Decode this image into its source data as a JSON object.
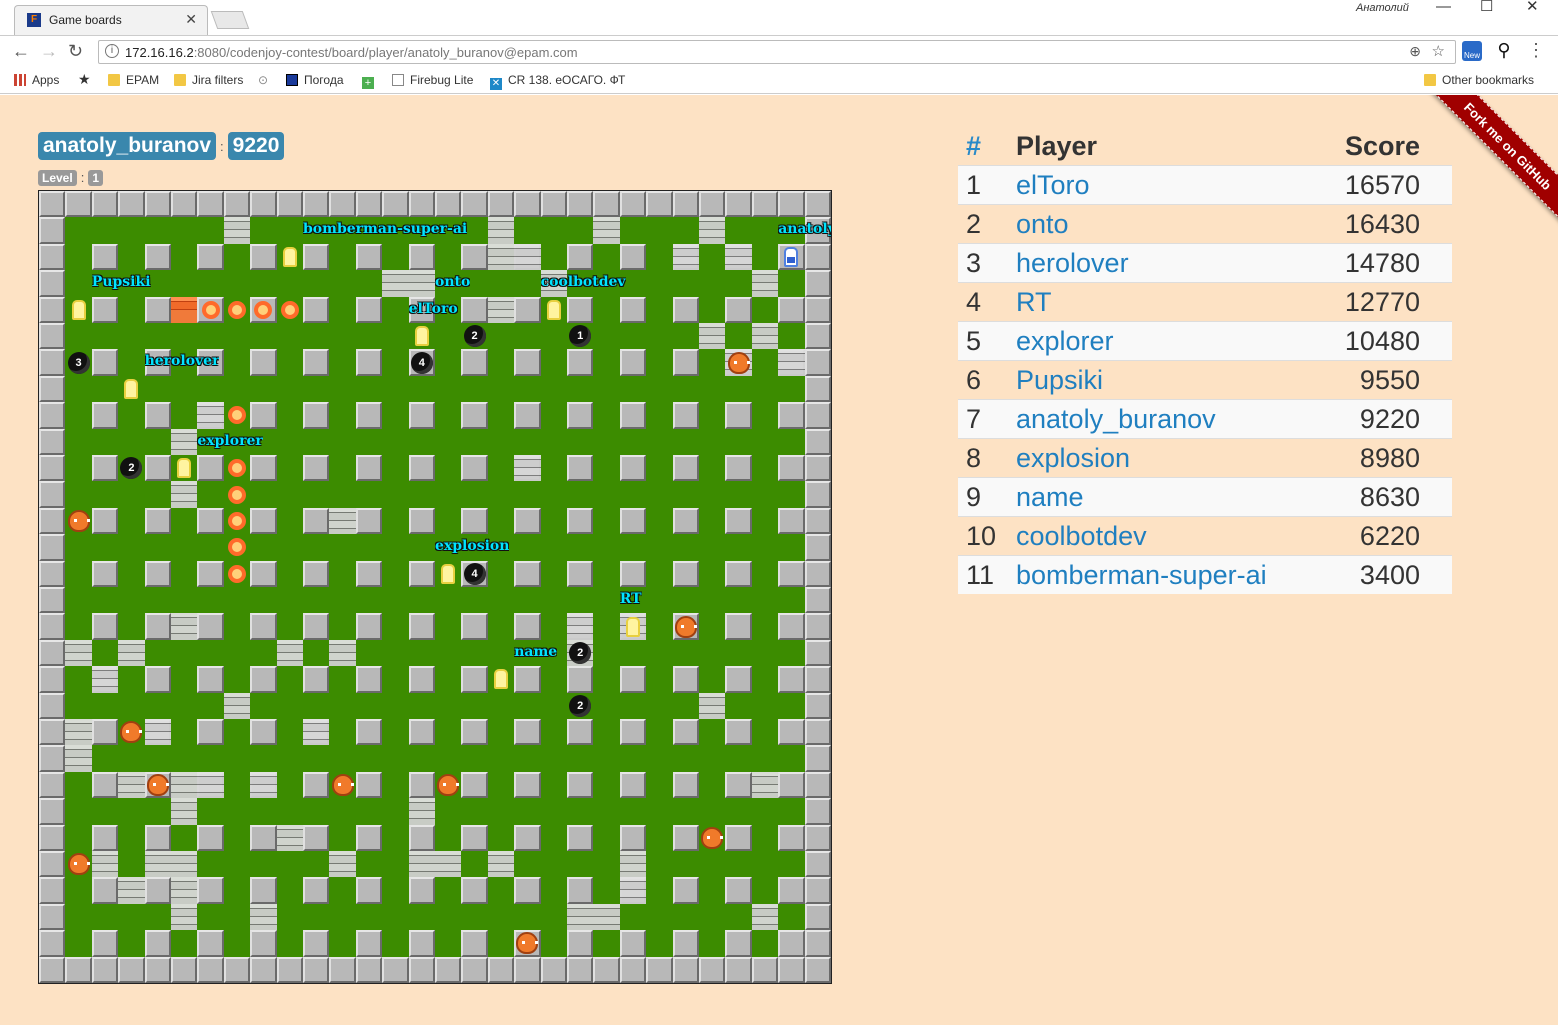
{
  "browser": {
    "tab_title": "Game boards",
    "tab_favicon": "F",
    "user_name": "Анатолий",
    "window_min": "—",
    "window_max": "☐",
    "window_close": "✕",
    "url_host": "172.16.16.2",
    "url_rest": ":8080/codenjoy-contest/board/player/anatoly_buranov@epam.com",
    "ext1_label": "New",
    "bookmarks": [
      {
        "label": "Apps",
        "icon": "apps-grid-icon"
      },
      {
        "label": "",
        "icon": "star-icon"
      },
      {
        "label": "EPAM",
        "icon": "folder-icon"
      },
      {
        "label": "Jira filters",
        "icon": "folder-icon"
      },
      {
        "label": "",
        "icon": "map-pin-icon"
      },
      {
        "label": "Погода",
        "icon": "weather-icon"
      },
      {
        "label": "",
        "icon": "plus-icon"
      },
      {
        "label": "Firebug Lite",
        "icon": "page-icon"
      },
      {
        "label": "CR 138. еОСАГО. ФТ",
        "icon": "x-icon"
      },
      {
        "label": "Other bookmarks",
        "icon": "folder-icon"
      }
    ]
  },
  "player": {
    "name": "anatoly_buranov",
    "separator": ":",
    "score": "9220",
    "level_label": "Level",
    "level": "1"
  },
  "ribbon_text": "Fork me on GitHub",
  "leaderboard": {
    "col_rank": "#",
    "col_player": "Player",
    "col_score": "Score",
    "rows": [
      {
        "rank": "1",
        "player": "elToro",
        "score": "16570"
      },
      {
        "rank": "2",
        "player": "onto",
        "score": "16430"
      },
      {
        "rank": "3",
        "player": "herolover",
        "score": "14780"
      },
      {
        "rank": "4",
        "player": "RT",
        "score": "12770"
      },
      {
        "rank": "5",
        "player": "explorer",
        "score": "10480"
      },
      {
        "rank": "6",
        "player": "Pupsiki",
        "score": "9550"
      },
      {
        "rank": "7",
        "player": "anatoly_buranov",
        "score": "9220"
      },
      {
        "rank": "8",
        "player": "explosion",
        "score": "8980"
      },
      {
        "rank": "9",
        "player": "name",
        "score": "8630"
      },
      {
        "rank": "10",
        "player": "coolbotdev",
        "score": "6220"
      },
      {
        "rank": "11",
        "player": "bomberman-super-ai",
        "score": "3400"
      }
    ]
  },
  "board": {
    "size": 30,
    "bricks": [
      [
        7,
        1
      ],
      [
        17,
        1
      ],
      [
        21,
        1
      ],
      [
        25,
        1
      ],
      [
        17,
        2
      ],
      [
        18,
        2
      ],
      [
        24,
        2
      ],
      [
        26,
        2
      ],
      [
        13,
        3
      ],
      [
        14,
        3
      ],
      [
        19,
        3
      ],
      [
        27,
        3
      ],
      [
        17,
        4
      ],
      [
        25,
        5
      ],
      [
        27,
        5
      ],
      [
        26,
        6
      ],
      [
        28,
        6
      ],
      [
        6,
        8
      ],
      [
        5,
        9
      ],
      [
        18,
        10
      ],
      [
        5,
        11
      ],
      [
        11,
        12
      ],
      [
        5,
        16
      ],
      [
        20,
        16
      ],
      [
        22,
        16
      ],
      [
        1,
        17
      ],
      [
        3,
        17
      ],
      [
        9,
        17
      ],
      [
        11,
        17
      ],
      [
        20,
        17
      ],
      [
        2,
        18
      ],
      [
        7,
        19
      ],
      [
        25,
        19
      ],
      [
        1,
        20
      ],
      [
        4,
        20
      ],
      [
        10,
        20
      ],
      [
        1,
        21
      ],
      [
        3,
        22
      ],
      [
        5,
        22
      ],
      [
        6,
        22
      ],
      [
        8,
        22
      ],
      [
        27,
        22
      ],
      [
        5,
        23
      ],
      [
        14,
        23
      ],
      [
        9,
        24
      ],
      [
        2,
        25
      ],
      [
        4,
        25
      ],
      [
        5,
        25
      ],
      [
        11,
        25
      ],
      [
        14,
        25
      ],
      [
        15,
        25
      ],
      [
        17,
        25
      ],
      [
        22,
        25
      ],
      [
        3,
        26
      ],
      [
        5,
        26
      ],
      [
        22,
        26
      ],
      [
        5,
        27
      ],
      [
        8,
        27
      ],
      [
        20,
        27
      ],
      [
        21,
        27
      ],
      [
        27,
        27
      ]
    ],
    "boom_bricks": [
      [
        5,
        4
      ]
    ],
    "blasts": [
      [
        6,
        4
      ],
      [
        7,
        4
      ],
      [
        8,
        4
      ],
      [
        9,
        4
      ],
      [
        7,
        8
      ],
      [
        7,
        10
      ],
      [
        7,
        11
      ],
      [
        7,
        12
      ],
      [
        7,
        13
      ],
      [
        7,
        14
      ]
    ],
    "bombs": [
      [
        16,
        5,
        "2"
      ],
      [
        20,
        5,
        "1"
      ],
      [
        1,
        6,
        "3"
      ],
      [
        14,
        6,
        "4"
      ],
      [
        3,
        10,
        "2"
      ],
      [
        16,
        14,
        "4"
      ],
      [
        20,
        17,
        "2"
      ],
      [
        20,
        19,
        "2"
      ]
    ],
    "choppers": [
      [
        26,
        6
      ],
      [
        1,
        12
      ],
      [
        24,
        16
      ],
      [
        3,
        20
      ],
      [
        4,
        22
      ],
      [
        11,
        22
      ],
      [
        15,
        22
      ],
      [
        25,
        24
      ],
      [
        1,
        25
      ],
      [
        18,
        28
      ]
    ],
    "heroes": [
      [
        9,
        2
      ],
      [
        1,
        4
      ],
      [
        19,
        4
      ],
      [
        14,
        5
      ],
      [
        3,
        7
      ],
      [
        5,
        10
      ],
      [
        15,
        14
      ],
      [
        22,
        16
      ],
      [
        17,
        18
      ]
    ],
    "me": [
      28,
      2
    ],
    "labels": [
      {
        "text": "bomberman-super-ai",
        "cell": [
          10,
          1
        ]
      },
      {
        "text": "anatoly_",
        "cell": [
          28,
          1
        ]
      },
      {
        "text": "Pupsiki",
        "cell": [
          2,
          3
        ]
      },
      {
        "text": "onto",
        "cell": [
          15,
          3
        ]
      },
      {
        "text": "coolbotdev",
        "cell": [
          19,
          3
        ]
      },
      {
        "text": "elToro",
        "cell": [
          14,
          4
        ]
      },
      {
        "text": "herolover",
        "cell": [
          4,
          6
        ]
      },
      {
        "text": "explorer",
        "cell": [
          6,
          9
        ]
      },
      {
        "text": "explosion",
        "cell": [
          15,
          13
        ]
      },
      {
        "text": "RT",
        "cell": [
          22,
          15
        ]
      },
      {
        "text": "name",
        "cell": [
          18,
          17
        ]
      }
    ]
  }
}
